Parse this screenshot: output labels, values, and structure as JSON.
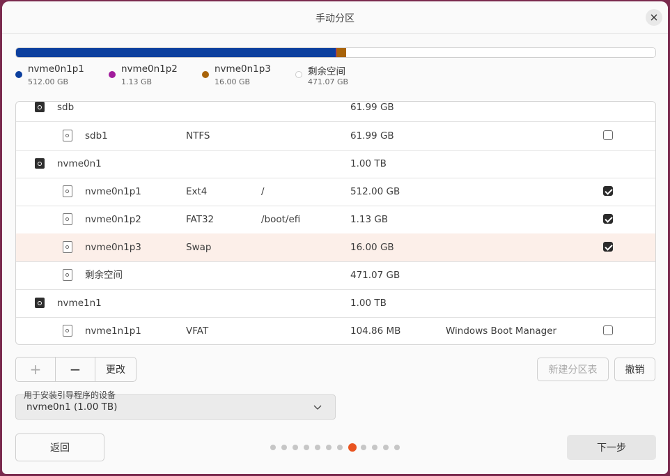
{
  "window": {
    "title": "手动分区"
  },
  "colors": {
    "p1": "#0c3f9e",
    "p2": "#a11c9c",
    "p3": "#a8630a",
    "free": "#ffffff",
    "accent": "#e95420"
  },
  "usage_bar": {
    "segments": [
      {
        "name": "nvme0n1p1",
        "fraction": 0.5,
        "color": "#0c3f9e"
      },
      {
        "name": "nvme0n1p2",
        "fraction": 0.0011,
        "color": "#a11c9c"
      },
      {
        "name": "nvme0n1p3",
        "fraction": 0.0156,
        "color": "#a8630a"
      },
      {
        "name": "剩余空间",
        "fraction": 0.4833,
        "color": "#ffffff"
      }
    ]
  },
  "legend": [
    {
      "name": "nvme0n1p1",
      "size": "512.00 GB"
    },
    {
      "name": "nvme0n1p2",
      "size": "1.13 GB"
    },
    {
      "name": "nvme0n1p3",
      "size": "16.00 GB"
    },
    {
      "name": "剩余空间",
      "size": "471.07 GB"
    }
  ],
  "table": {
    "rows": [
      {
        "kind": "disk",
        "device": "sdb",
        "type": "",
        "mount": "",
        "size": "61.99 GB",
        "system": "",
        "format": null
      },
      {
        "kind": "part",
        "device": "sdb1",
        "type": "NTFS",
        "mount": "",
        "size": "61.99 GB",
        "system": "",
        "format": false
      },
      {
        "kind": "disk",
        "device": "nvme0n1",
        "type": "",
        "mount": "",
        "size": "1.00 TB",
        "system": "",
        "format": null
      },
      {
        "kind": "part",
        "device": "nvme0n1p1",
        "type": "Ext4",
        "mount": "/",
        "size": "512.00 GB",
        "system": "",
        "format": true
      },
      {
        "kind": "part",
        "device": "nvme0n1p2",
        "type": "FAT32",
        "mount": "/boot/efi",
        "size": "1.13 GB",
        "system": "",
        "format": true
      },
      {
        "kind": "part",
        "device": "nvme0n1p3",
        "type": "Swap",
        "mount": "",
        "size": "16.00 GB",
        "system": "",
        "format": true,
        "selected": true
      },
      {
        "kind": "part",
        "device": "剩余空间",
        "type": "",
        "mount": "",
        "size": "471.07 GB",
        "system": "",
        "format": null
      },
      {
        "kind": "disk",
        "device": "nvme1n1",
        "type": "",
        "mount": "",
        "size": "1.00 TB",
        "system": "",
        "format": null
      },
      {
        "kind": "part",
        "device": "nvme1n1p1",
        "type": "VFAT",
        "mount": "",
        "size": "104.86 MB",
        "system": "Windows Boot Manager",
        "format": false
      }
    ]
  },
  "toolbar": {
    "add": "+",
    "remove": "−",
    "change": "更改",
    "new_table": "新建分区表",
    "revert": "撤销"
  },
  "bootloader": {
    "label": "用于安装引导程序的设备",
    "value": "nvme0n1  (1.00 TB)"
  },
  "nav": {
    "back": "返回",
    "next": "下一步",
    "step_count": 12,
    "current_step": 8
  }
}
